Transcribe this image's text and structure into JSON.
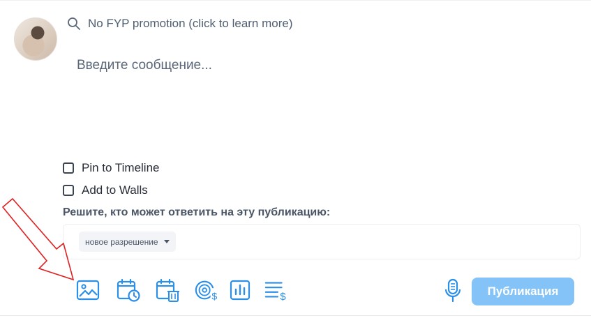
{
  "composer": {
    "fyp_text": "No FYP promotion (click to learn more)",
    "message_placeholder": "Введите сообщение...",
    "options": [
      {
        "label": "Pin to Timeline"
      },
      {
        "label": "Add to Walls"
      }
    ],
    "reply_permission_title": "Решите, кто может ответить на эту публикацию:",
    "reply_permission_value": "новое разрешение",
    "publish_label": "Публикация"
  },
  "toolbar": {
    "icons": [
      "image-icon",
      "schedule-post-icon",
      "auto-delete-icon",
      "paid-message-icon",
      "poll-icon",
      "price-list-icon"
    ]
  },
  "colors": {
    "accent": "#2b8fe8",
    "publish_disabled": "#83c3f7",
    "annotation_arrow": "#e02020"
  }
}
